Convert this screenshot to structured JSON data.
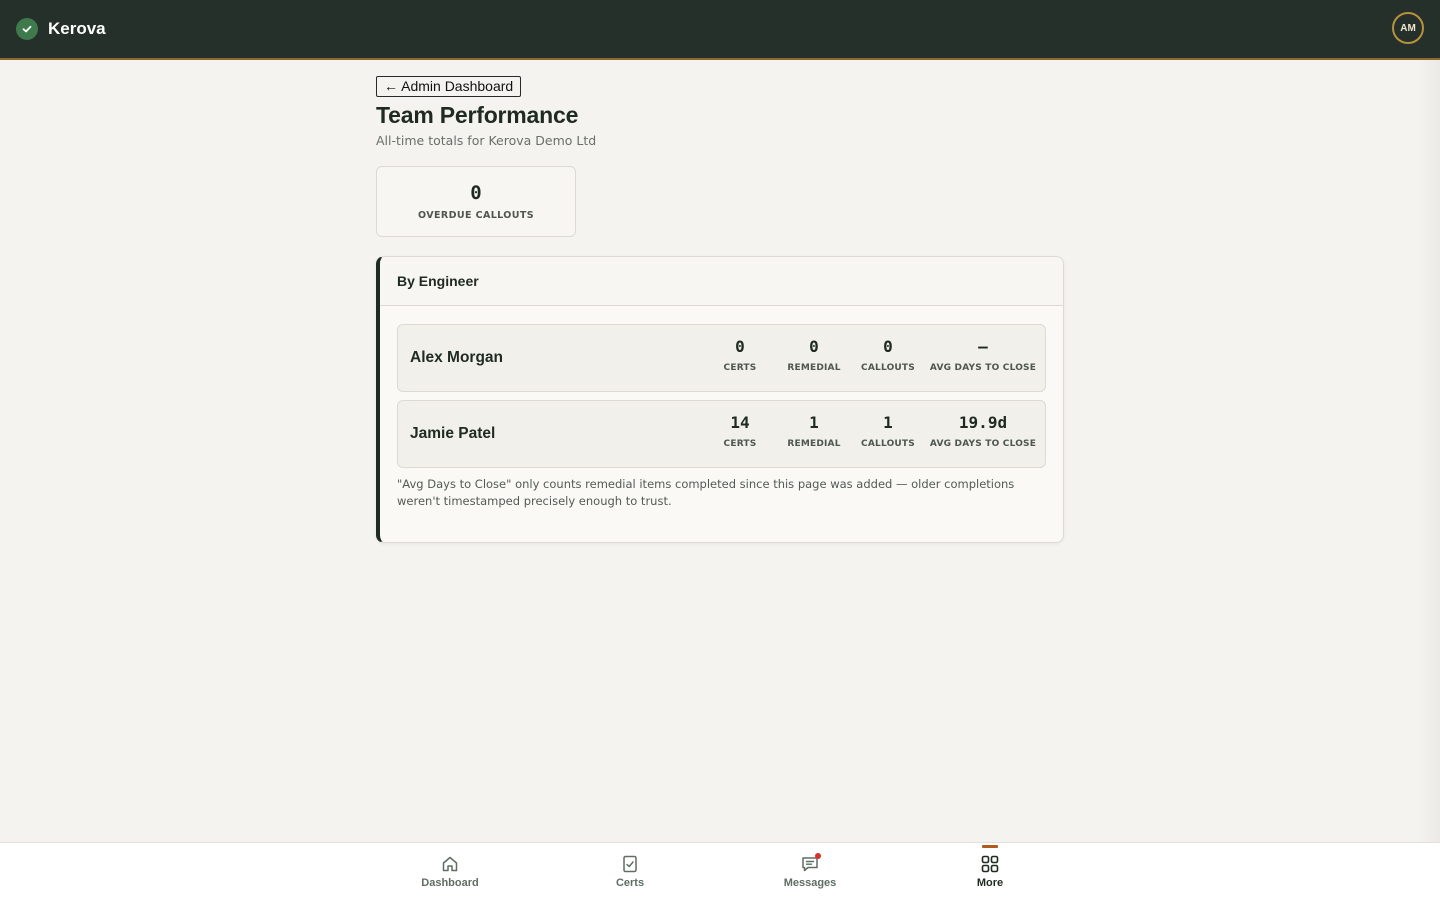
{
  "app": {
    "name": "Kerova",
    "user_initials": "AM"
  },
  "nav": {
    "back_label": "← Admin Dashboard"
  },
  "page": {
    "title": "Team Performance",
    "subtitle": "All-time totals for Kerova Demo Ltd"
  },
  "summary": {
    "overdue_callouts_value": "0",
    "overdue_callouts_label": "OVERDUE CALLOUTS"
  },
  "by_engineer": {
    "heading": "By Engineer",
    "column_labels": {
      "certs": "CERTS",
      "remedial": "REMEDIAL",
      "callouts": "CALLOUTS",
      "avg_days": "AVG DAYS TO CLOSE"
    },
    "engineers": [
      {
        "name": "Alex Morgan",
        "certs": "0",
        "remedial": "0",
        "callouts": "0",
        "avg_days": "—"
      },
      {
        "name": "Jamie Patel",
        "certs": "14",
        "remedial": "1",
        "callouts": "1",
        "avg_days": "19.9d"
      }
    ],
    "footnote": "\"Avg Days to Close\" only counts remedial items completed since this page was added — older completions weren't timestamped precisely enough to trust."
  },
  "bottom_nav": {
    "items": [
      {
        "label": "Dashboard",
        "icon": "home-icon",
        "active": false
      },
      {
        "label": "Certs",
        "icon": "certificate-icon",
        "active": false
      },
      {
        "label": "Messages",
        "icon": "message-icon",
        "active": false,
        "has_notification": true
      },
      {
        "label": "More",
        "icon": "grid-icon",
        "active": true
      }
    ]
  },
  "colors": {
    "topbar": "#26302a",
    "accent": "#b25b1e",
    "brand_green": "#3f7a4c",
    "notification": "#d9302c"
  }
}
